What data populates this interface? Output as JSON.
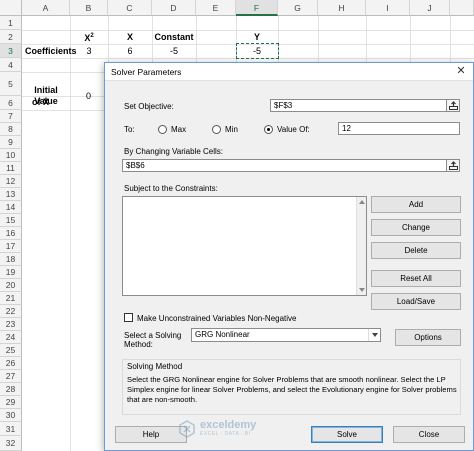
{
  "sheet": {
    "columns": [
      "A",
      "B",
      "C",
      "D",
      "E",
      "F",
      "G",
      "H",
      "I",
      "J"
    ],
    "selected_column": "F",
    "rows": [
      "1",
      "2",
      "3",
      "4",
      "5",
      "6",
      "7",
      "8",
      "9",
      "10",
      "11",
      "12",
      "13",
      "14",
      "15",
      "16",
      "17",
      "18",
      "19",
      "20",
      "21",
      "22",
      "23",
      "24",
      "25",
      "26",
      "27",
      "28",
      "29",
      "30",
      "31",
      "32"
    ],
    "selected_row": "3",
    "cells": {
      "b2": "X",
      "b2_sup": "2",
      "c2": "X",
      "d2": "Constant",
      "f2": "Y",
      "a3": "Coefficients",
      "b3": "3",
      "c3": "6",
      "d3": "-5",
      "f3": "-5",
      "a5_line1": "Initial Value",
      "a5_line2": "of X",
      "b5": "0"
    }
  },
  "dialog": {
    "title": "Solver Parameters",
    "close_glyph": "✕",
    "set_objective_label": "Set Objective:",
    "objective_value": "$F$3",
    "to_label": "To:",
    "max_label": "Max",
    "min_label": "Min",
    "value_of_label": "Value Of:",
    "value_of_value": "12",
    "selected_target": "value_of",
    "changing_cells_label": "By Changing Variable Cells:",
    "changing_cells_value": "$B$6",
    "constraints_label": "Subject to the Constraints:",
    "buttons": {
      "add": "Add",
      "change": "Change",
      "delete": "Delete",
      "reset_all": "Reset All",
      "load_save": "Load/Save",
      "options": "Options",
      "help": "Help",
      "solve": "Solve",
      "close": "Close"
    },
    "make_nonneg_label": "Make Unconstrained Variables Non-Negative",
    "make_nonneg_checked": false,
    "select_method_label_1": "Select a Solving",
    "select_method_label_2": "Method:",
    "method_value": "GRG Nonlinear",
    "solving_method_title": "Solving Method",
    "solving_method_text": "Select the GRG Nonlinear engine for Solver Problems that are smooth nonlinear. Select the LP Simplex engine for linear Solver Problems, and select the Evolutionary engine for Solver problems that are non-smooth."
  },
  "watermark": {
    "name": "exceldemy",
    "tagline": "EXCEL · DATA · BI"
  },
  "colors": {
    "excel_green": "#217346",
    "dialog_bg": "#f0f0f0"
  },
  "icons": {
    "range_selector": "collapse-dialog-icon",
    "close": "close-icon",
    "dropdown": "chevron-down-icon"
  }
}
